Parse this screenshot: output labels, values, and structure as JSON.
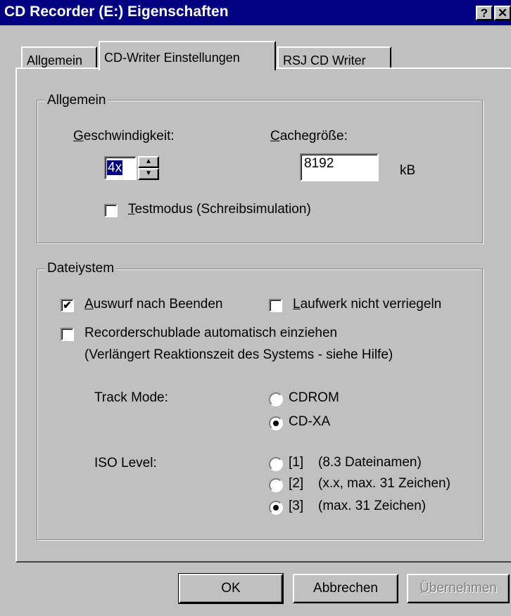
{
  "window": {
    "title": "CD Recorder (E:) Eigenschaften",
    "help_btn": "?",
    "close_btn": "✕"
  },
  "tabs": [
    {
      "label": "Allgemein"
    },
    {
      "label": "CD-Writer Einstellungen"
    },
    {
      "label": "RSJ CD Writer"
    }
  ],
  "general": {
    "legend": "Allgemein",
    "speed_label_u": "G",
    "speed_label_rest": "eschwindigkeit:",
    "speed_value": "4x",
    "cache_label_u": "C",
    "cache_label_rest": "achegröße:",
    "cache_value": "8192",
    "cache_unit": "kB",
    "testmode_u": "T",
    "testmode_rest": "estmodus (Schreibsimulation)",
    "testmode_checked": false
  },
  "filesystem": {
    "legend": "Dateiystem",
    "eject_u": "A",
    "eject_rest": "uswurf nach Beenden",
    "eject_checked": true,
    "nolock_u": "L",
    "nolock_rest": "aufwerk nicht verriegeln",
    "nolock_checked": false,
    "tray_line1": "Recorderschublade automatisch einziehen",
    "tray_line2": "(Verlängert Reaktionszeit des Systems - siehe Hilfe)",
    "tray_checked": false,
    "track_mode_label": "Track Mode:",
    "track_modes": [
      {
        "label": "CDROM",
        "selected": false
      },
      {
        "label": "CD-XA",
        "selected": true
      }
    ],
    "iso_label": "ISO Level:",
    "iso_levels": [
      {
        "num": "[1]",
        "desc": "(8.3 Dateinamen)",
        "selected": false
      },
      {
        "num": "[2]",
        "desc": "(x.x, max. 31 Zeichen)",
        "selected": false
      },
      {
        "num": "[3]",
        "desc": "(max. 31 Zeichen)",
        "selected": true
      }
    ]
  },
  "buttons": {
    "ok": "OK",
    "cancel": "Abbrechen",
    "apply_u": "Ü",
    "apply_rest": "bernehmen"
  }
}
